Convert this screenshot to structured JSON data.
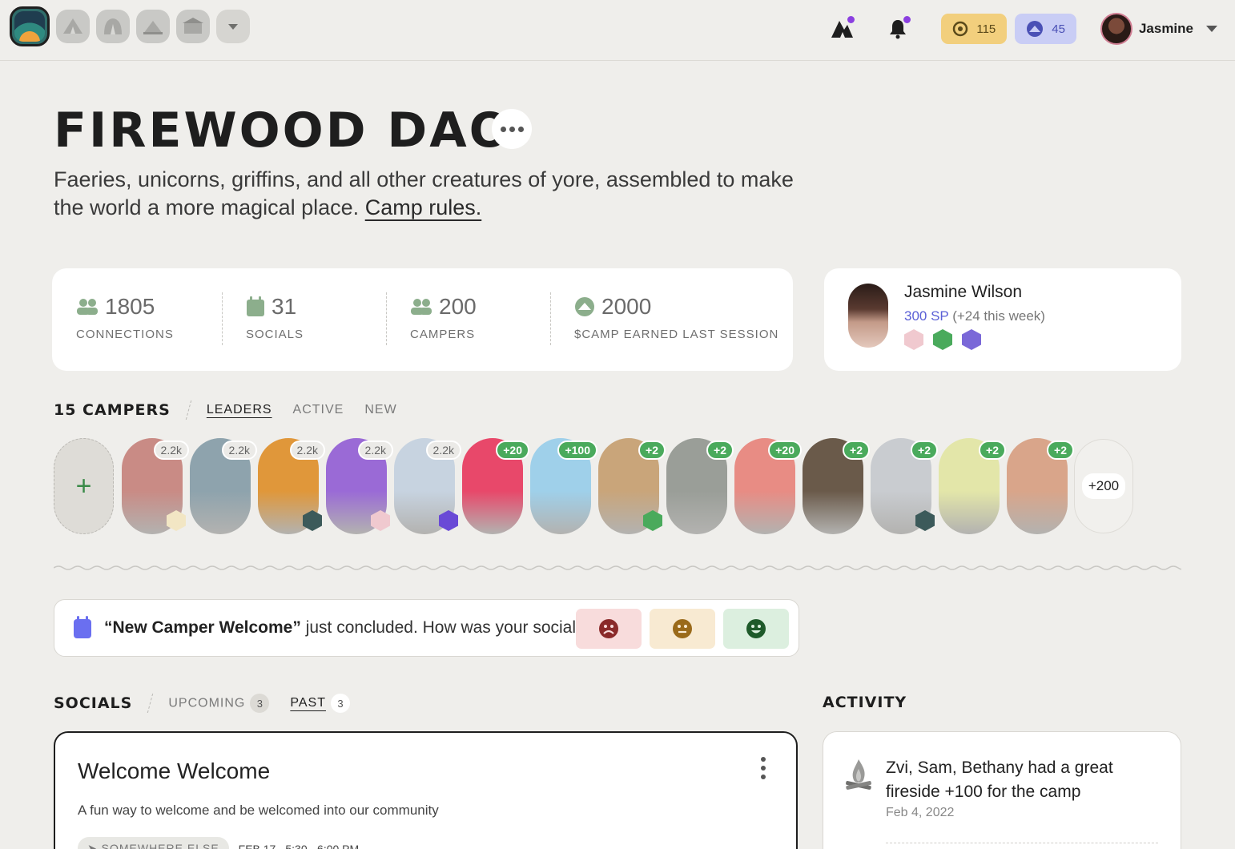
{
  "topbar": {
    "camps": [
      "firewood-camp",
      "camp-2",
      "camp-3",
      "camp-4",
      "camp-5"
    ],
    "coins": "115",
    "camp_tokens": "45",
    "user_name": "Jasmine"
  },
  "header": {
    "title": "FIREWOOD DAO",
    "description": "Faeries, unicorns, griffins, and all other creatures of yore, assembled to make the world a more magical place.",
    "rules_link": "Camp rules."
  },
  "stats": [
    {
      "value": "1805",
      "label": "CONNECTIONS",
      "icon": "people-icon"
    },
    {
      "value": "31",
      "label": "SOCIALS",
      "icon": "calendar-icon"
    },
    {
      "value": "200",
      "label": "CAMPERS",
      "icon": "people-icon"
    },
    {
      "value": "2000",
      "label": "$CAMP EARNED LAST SESSION",
      "icon": "camp-token-icon"
    }
  ],
  "profile": {
    "name": "Jasmine Wilson",
    "sp": "300 SP",
    "sp_delta": "(+24 this week)"
  },
  "campers": {
    "heading": "15 CAMPERS",
    "tabs": [
      "LEADERS",
      "ACTIVE",
      "NEW"
    ],
    "active_tab": "LEADERS",
    "list": [
      {
        "chip": "2.2k",
        "chip_type": "grey",
        "color": "#c98b85"
      },
      {
        "chip": "2.2k",
        "chip_type": "grey",
        "color": "#8ea3ad"
      },
      {
        "chip": "2.2k",
        "chip_type": "grey",
        "color": "#e0973a"
      },
      {
        "chip": "2.2k",
        "chip_type": "grey",
        "color": "#9a6ad6"
      },
      {
        "chip": "2.2k",
        "chip_type": "grey",
        "color": "#c7d3e0"
      },
      {
        "chip": "+20",
        "chip_type": "green",
        "color": "#e8486a"
      },
      {
        "chip": "+100",
        "chip_type": "green",
        "color": "#9fd0ea"
      },
      {
        "chip": "+2",
        "chip_type": "green",
        "color": "#c9a57a"
      },
      {
        "chip": "+2",
        "chip_type": "green",
        "color": "#9a9e98"
      },
      {
        "chip": "+20",
        "chip_type": "green",
        "color": "#e88c84"
      },
      {
        "chip": "+2",
        "chip_type": "green",
        "color": "#6a5a4a"
      },
      {
        "chip": "+2",
        "chip_type": "green",
        "color": "#c9ccd0"
      },
      {
        "chip": "+2",
        "chip_type": "green",
        "color": "#e3e6a9"
      },
      {
        "chip": "+2",
        "chip_type": "green",
        "color": "#d9a58a"
      }
    ],
    "more": "+200"
  },
  "feedback": {
    "social_name": "“New Camper Welcome”",
    "text": " just concluded. How was your social?"
  },
  "socials": {
    "heading": "SOCIALS",
    "upcoming_label": "UPCOMING",
    "upcoming_count": "3",
    "past_label": "PAST",
    "past_count": "3",
    "card": {
      "title": "Welcome Welcome",
      "description": "A fun way to welcome and be welcomed into our community",
      "location": "SOMEWHERE ELSE",
      "date": "FEB 17",
      "time": "5:30 - 6:00 PM"
    }
  },
  "activity": {
    "heading": "ACTIVITY",
    "item_text": "Zvi, Sam, Bethany had a great fireside +100 for the camp",
    "item_date": "Feb 4, 2022"
  }
}
